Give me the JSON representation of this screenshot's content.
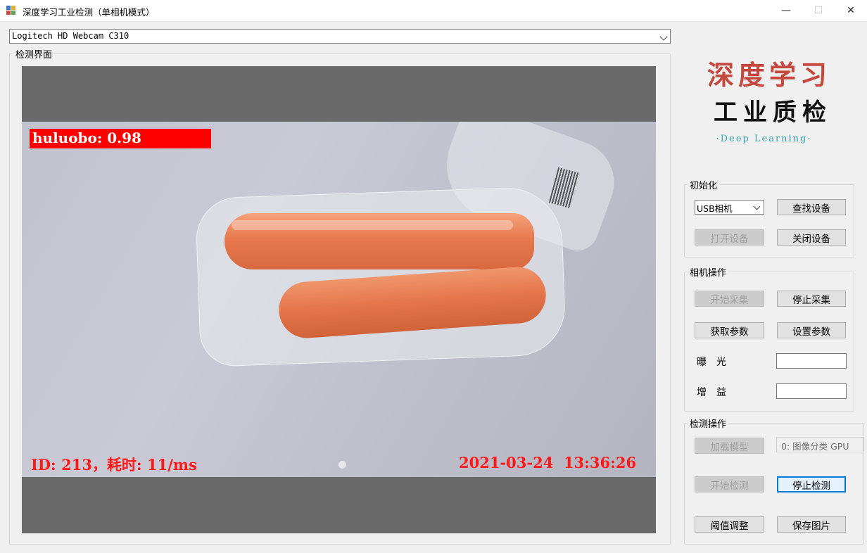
{
  "window": {
    "title": "深度学习工业检测（单相机模式）",
    "minimize": "—",
    "maximize": "☐",
    "close": "✕"
  },
  "device_combo": {
    "value": "Logitech HD Webcam C310"
  },
  "detection_panel": {
    "label": "检测界面",
    "overlay": {
      "class_label": "huluobo: 0.98",
      "id_text": "ID: 213，耗时: 11/ms",
      "timestamp": "2021-03-24  13:36:26"
    }
  },
  "logo": {
    "line1": "深度学习",
    "line2": "工业质检",
    "line3": "·Deep Learning·",
    "accent": "#c4483d",
    "tagline_color": "#2ea3a8"
  },
  "init_group": {
    "label": "初始化",
    "camera_type": "USB相机",
    "find_device": "查找设备",
    "open_device": "打开设备",
    "close_device": "关闭设备"
  },
  "camera_group": {
    "label": "相机操作",
    "start_capture": "开始采集",
    "stop_capture": "停止采集",
    "get_params": "获取参数",
    "set_params": "设置参数",
    "exposure_label": "曝　光",
    "exposure_value": "",
    "gain_label": "增　益",
    "gain_value": ""
  },
  "detect_group": {
    "label": "检测操作",
    "load_model": "加载模型",
    "model_info": "0: 图像分类 GPU",
    "start_detect": "开始检测",
    "stop_detect": "停止检测",
    "threshold": "阈值调整",
    "save_image": "保存图片"
  }
}
